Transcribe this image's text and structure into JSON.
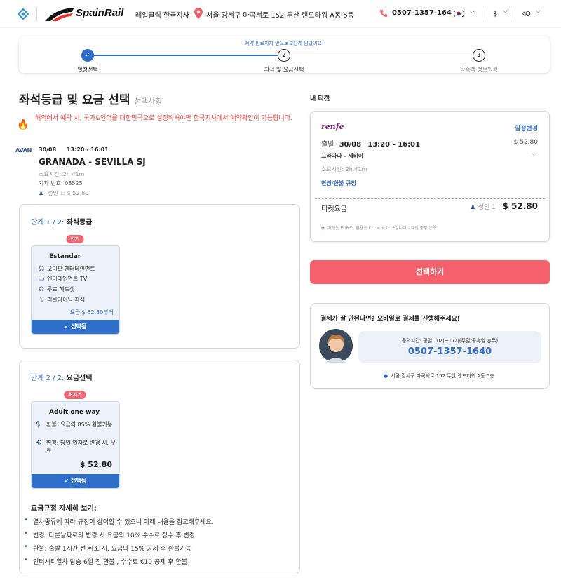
{
  "header": {
    "logo_text": "SpainRail",
    "branch": "레일클릭 한국지사",
    "address": "서울 강서구 마곡서로 152 두산 랜드타워 A동 5층",
    "phone": "0507-1357-1640",
    "currency": "$",
    "language": "KO"
  },
  "stepper": {
    "notice": "예약 완료까지 앞으로 2단계 남았어요!",
    "steps": [
      {
        "num": "✓",
        "label": "일정선택",
        "state": "done"
      },
      {
        "num": "2",
        "label": "좌석 및 요금선택",
        "state": "current"
      },
      {
        "num": "3",
        "label": "탑승객 정보입력",
        "state": "pending"
      }
    ]
  },
  "main": {
    "title": "좌석등급 및 요금 선택",
    "title_sub": "선택사항",
    "warning": "해외에서 예약 시, 국가&언어를 대한민국으로 설정하셔야만 한국지사에서 예약확인이 가능합니다.",
    "trip": {
      "operator_logo": "AVAN",
      "date": "30/08",
      "time": "13:20 - 16:01",
      "route": "GRANADA - SEVILLA SJ",
      "duration": "소요시간: 2h 41m",
      "train_no": "기차 번호: 08525",
      "passenger": "성인 1:  $ 52.80"
    },
    "step1": {
      "title_prefix": "단계 1 / 2:",
      "title": "좌석등급",
      "badge": "인기",
      "option_name": "Estandar",
      "features": [
        {
          "icon": "headphones-icon",
          "label": "오디오 엔터테인먼트"
        },
        {
          "icon": "tv-icon",
          "label": "엔터테인먼트 TV"
        },
        {
          "icon": "headphones-icon",
          "label": "무료 헤드셋"
        },
        {
          "icon": "reclining-seat-icon",
          "label": "리클라이닝 좌석"
        }
      ],
      "price": "요금 $ 52.80부터",
      "button": "✓ 선택됨"
    },
    "step2": {
      "title_prefix": "단계 2 / 2:",
      "title": "요금선택",
      "badge": "최저가",
      "option_name": "Adult one way",
      "features": [
        {
          "icon": "refund-icon",
          "label": "환불: 요금의 85% 환불가능"
        },
        {
          "icon": "exchange-icon",
          "label": "변경: 당일 열차로 변경 시, 무료"
        }
      ],
      "price": "$ 52.80",
      "button": "✓ 선택됨"
    },
    "rules": {
      "title": "요금규정 자세히 보기:",
      "items": [
        "열차종류에 따라 규정이 상이할 수 있으니 아래 내용을 참고해주세요.",
        "변경: 다른날짜로의 변경 시 요금의 10% 수수료 징수 후 변경",
        "환불: 출발 1시간 전 취소 시, 요금의 15% 공제 후 환불가능",
        "인터시티열차 탑승 6일 전 환불 , 수수료 €19 공제 후 환불"
      ]
    }
  },
  "ticket": {
    "heading": "내 티켓",
    "operator": "renfe",
    "change_link": "일정변경",
    "depart_label": "출발",
    "date": "30/08",
    "time": "13:20 - 16:01",
    "price": "$ 52.80",
    "route": "그라나다 - 세비야",
    "duration": "소요시간: 2h 41m",
    "rules_link": "변경/환불 규정",
    "fare_label": "티켓요금",
    "fare_passenger": "성인 1",
    "fare_total": "$ 52.80",
    "exchange_note": "거래는 EUR로, 환율은 € 1 = $ 1.12입니다 - 유럽 중앙 은행"
  },
  "select_button": "선택하기",
  "support": {
    "title": "결제가 잘 안된다면? 모바일로 결제를 진행해주세요!",
    "hours": "문의시간: 평일 10시~17시(주말/공휴일 휴무)",
    "phone": "0507-1357-1640",
    "address": "서울 강서구 마곡서로 152 두산 랜드타워 A동 5층"
  },
  "colors": {
    "accent_blue": "#2f6ec9",
    "accent_red": "#f4606c",
    "warning_red": "#e8423f"
  }
}
